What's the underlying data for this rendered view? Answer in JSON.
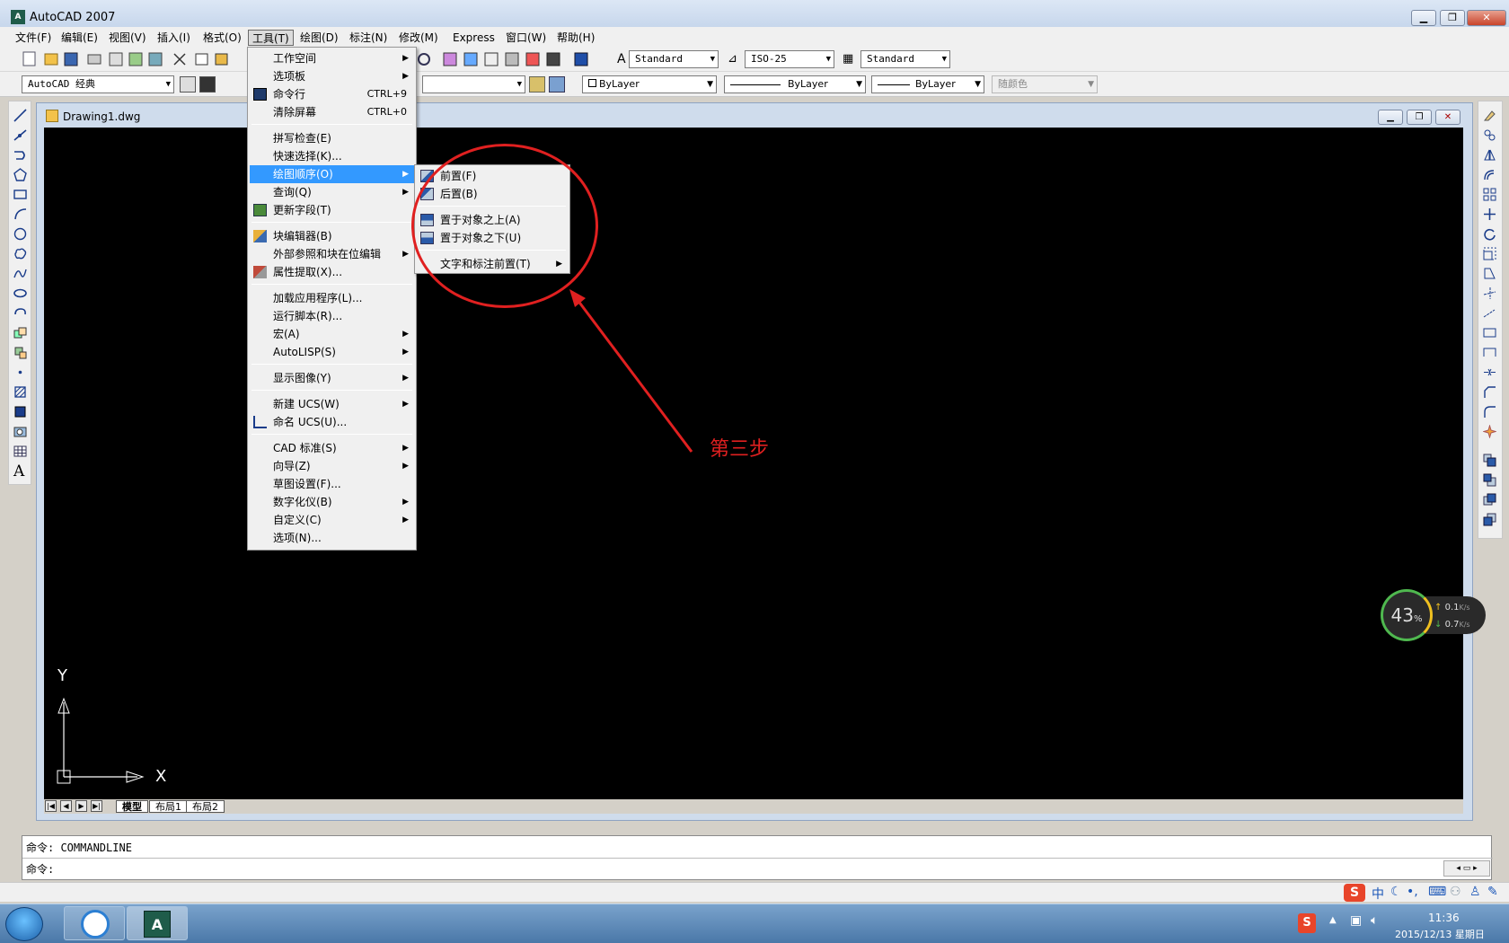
{
  "window": {
    "title": "AutoCAD 2007"
  },
  "menubar": {
    "items": [
      "文件(F)",
      "编辑(E)",
      "视图(V)",
      "插入(I)",
      "格式(O)",
      "工具(T)",
      "绘图(D)",
      "标注(N)",
      "修改(M)",
      "Express",
      "窗口(W)",
      "帮助(H)"
    ]
  },
  "toolbar": {
    "text_style": "Standard",
    "dim_style": "ISO-25",
    "table_style": "Standard",
    "workspace": "AutoCAD 经典",
    "layer_color": "ByLayer",
    "linetype": "ByLayer",
    "lineweight": "ByLayer",
    "plot_style": "随颜色"
  },
  "document": {
    "title": "Drawing1.dwg"
  },
  "layout_tabs": [
    "模型",
    "布局1",
    "布局2"
  ],
  "ucs": {
    "x_label": "X",
    "y_label": "Y"
  },
  "tools_menu": {
    "items": [
      {
        "label": "工作空间",
        "sub": true
      },
      {
        "label": "选项板",
        "sub": true
      },
      {
        "label": "命令行",
        "shortcut": "CTRL+9"
      },
      {
        "label": "清除屏幕",
        "shortcut": "CTRL+0"
      },
      {
        "label": "拼写检查(E)"
      },
      {
        "label": "快速选择(K)..."
      },
      {
        "label": "绘图顺序(O)",
        "sub": true,
        "highlighted": true
      },
      {
        "label": "查询(Q)",
        "sub": true
      },
      {
        "label": "更新字段(T)"
      },
      {
        "label": "块编辑器(B)"
      },
      {
        "label": "外部参照和块在位编辑",
        "sub": true
      },
      {
        "label": "属性提取(X)..."
      },
      {
        "label": "加载应用程序(L)..."
      },
      {
        "label": "运行脚本(R)..."
      },
      {
        "label": "宏(A)",
        "sub": true
      },
      {
        "label": "AutoLISP(S)",
        "sub": true
      },
      {
        "label": "显示图像(Y)",
        "sub": true
      },
      {
        "label": "新建 UCS(W)",
        "sub": true
      },
      {
        "label": "命名 UCS(U)..."
      },
      {
        "label": "CAD 标准(S)",
        "sub": true
      },
      {
        "label": "向导(Z)",
        "sub": true
      },
      {
        "label": "草图设置(F)..."
      },
      {
        "label": "数字化仪(B)",
        "sub": true
      },
      {
        "label": "自定义(C)",
        "sub": true
      },
      {
        "label": "选项(N)..."
      }
    ]
  },
  "draworder_menu": {
    "items": [
      {
        "label": "前置(F)"
      },
      {
        "label": "后置(B)"
      },
      {
        "label": "置于对象之上(A)"
      },
      {
        "label": "置于对象之下(U)"
      },
      {
        "label": "文字和标注前置(T)",
        "sub": true
      }
    ]
  },
  "annotation": {
    "text": "第三步",
    "color": "#e02020"
  },
  "command": {
    "history": "命令: COMMANDLINE",
    "prompt": "命令:"
  },
  "net_widget": {
    "percent": "43",
    "percent_unit": "%",
    "up": "0.1",
    "down": "0.7",
    "unit": "K/s"
  },
  "clock": {
    "time": "11:36",
    "date": "2015/12/13 星期日"
  },
  "ime": {
    "mode": "中"
  }
}
